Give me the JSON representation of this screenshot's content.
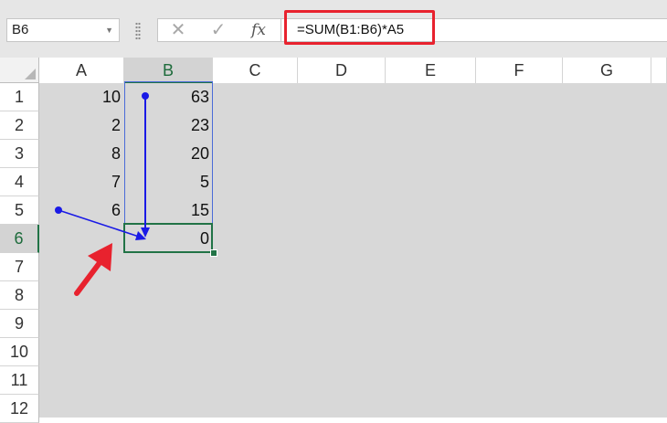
{
  "name_box": {
    "value": "B6"
  },
  "formula_bar": {
    "cancel_icon": "✕",
    "enter_icon": "✓",
    "fx_label": "fx",
    "formula": "=SUM(B1:B6)*A5"
  },
  "columns": [
    "A",
    "B",
    "C",
    "D",
    "E",
    "F",
    "G"
  ],
  "rows": [
    "1",
    "2",
    "3",
    "4",
    "5",
    "6",
    "7",
    "8",
    "9",
    "10",
    "11",
    "12"
  ],
  "cells": {
    "A1": "10",
    "A2": "2",
    "A3": "8",
    "A4": "7",
    "A5": "6",
    "B1": "63",
    "B2": "23",
    "B3": "20",
    "B4": "5",
    "B5": "15",
    "B6": "0"
  },
  "active_cell": "B6",
  "colors": {
    "accent_green": "#217346",
    "trace_arrow_blue": "#1a1ae6",
    "callout_red": "#e8222e"
  },
  "icons": [
    "cancel-icon",
    "enter-icon",
    "function-icon",
    "dropdown-arrow-icon",
    "trace-precedents-arrow",
    "callout-arrow-icon"
  ]
}
